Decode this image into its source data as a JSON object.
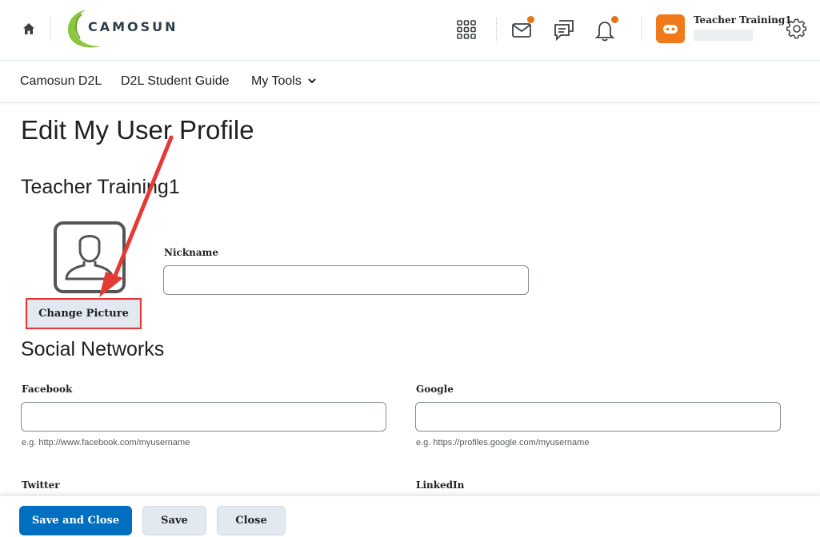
{
  "header": {
    "logo_text": "CAMOSUN",
    "user_name": "Teacher Training1"
  },
  "nav": {
    "items": [
      {
        "label": "Camosun D2L"
      },
      {
        "label": "D2L Student Guide"
      },
      {
        "label": "My Tools"
      }
    ]
  },
  "page": {
    "title": "Edit My User Profile",
    "user_heading": "Teacher Training1",
    "change_picture_label": "Change Picture",
    "nickname_label": "Nickname",
    "nickname_value": "",
    "social_heading": "Social Networks"
  },
  "social": {
    "facebook": {
      "label": "Facebook",
      "value": "",
      "hint": "e.g. http://www.facebook.com/myusername"
    },
    "google": {
      "label": "Google",
      "value": "",
      "hint": "e.g. https://profiles.google.com/myusername"
    },
    "twitter": {
      "label": "Twitter",
      "value": ""
    },
    "linkedin": {
      "label": "LinkedIn",
      "value": ""
    }
  },
  "footer": {
    "save_close_label": "Save and Close",
    "save_label": "Save",
    "close_label": "Close"
  },
  "colors": {
    "accent": "#006fbf",
    "notification": "#e87511",
    "annotation": "#e53935",
    "logo_green": "#8cc63f"
  },
  "icons": [
    "home-icon",
    "waffle-icon",
    "mail-icon",
    "chat-icon",
    "bell-icon",
    "user-avatar-icon",
    "gear-icon",
    "profile-placeholder-icon",
    "chevron-down-icon"
  ]
}
